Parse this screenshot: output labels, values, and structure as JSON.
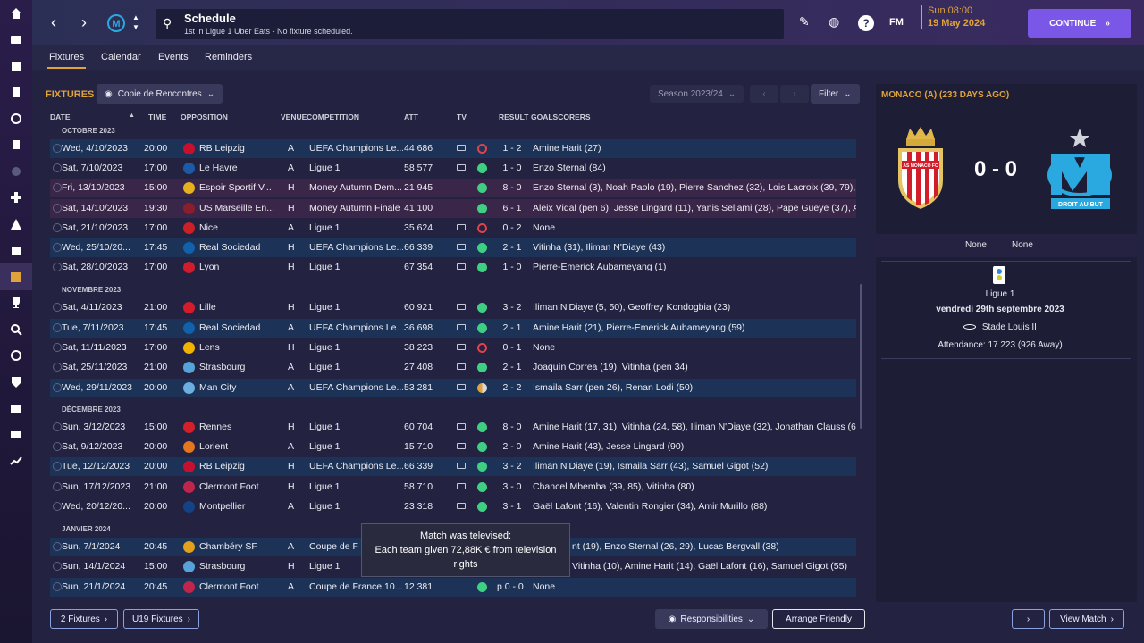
{
  "header": {
    "title": "Schedule",
    "subtitle": "1st in Ligue 1 Uber Eats - No fixture scheduled.",
    "fm_label": "FM",
    "date_time": "Sun 08:00",
    "date": "19 May 2024",
    "continue_label": "CONTINUE"
  },
  "tabs": [
    "Fixtures",
    "Calendar",
    "Events",
    "Reminders"
  ],
  "toolbar": {
    "fixtures_title": "FIXTURES",
    "view_dropdown": "Copie de Rencontres",
    "season": "Season 2023/24",
    "filter_label": "Filter"
  },
  "table": {
    "columns": [
      "DATE",
      "TIME",
      "OPPOSITION",
      "VENUE",
      "COMPETITION",
      "ATT",
      "TV",
      "RESULT",
      "GOALSCORERS"
    ],
    "sections": [
      "OCTOBRE 2023",
      "NOVEMBRE 2023",
      "DÉCEMBRE 2023",
      "JANVIER 2024"
    ],
    "rows": [
      {
        "date": "Wed, 4/10/2023",
        "time": "20:00",
        "opp": "RB Leipzig",
        "venue": "A",
        "comp": "UEFA Champions Le...",
        "att": "44 686",
        "result": "1 - 2",
        "scorers": "Amine Harit (27)"
      },
      {
        "date": "Sat, 7/10/2023",
        "time": "17:00",
        "opp": "Le Havre",
        "venue": "A",
        "comp": "Ligue 1",
        "att": "58 577",
        "result": "1 - 0",
        "scorers": "Enzo Sternal (84)"
      },
      {
        "date": "Fri, 13/10/2023",
        "time": "15:00",
        "opp": "Espoir Sportif V...",
        "venue": "H",
        "comp": "Money Autumn Dem...",
        "att": "21 945",
        "result": "8 - 0",
        "scorers": "Enzo Sternal (3), Noah Paolo (19), Pierre Sanchez (32), Lois Lacroix (39, 79), Joa"
      },
      {
        "date": "Sat, 14/10/2023",
        "time": "19:30",
        "opp": "US Marseille En...",
        "venue": "H",
        "comp": "Money Autumn Finale",
        "att": "41 100",
        "result": "6 - 1",
        "scorers": "Aleix Vidal (pen 6), Jesse Lingard (11), Yanis Sellami (28), Pape Gueye (37), Ama..."
      },
      {
        "date": "Sat, 21/10/2023",
        "time": "17:00",
        "opp": "Nice",
        "venue": "A",
        "comp": "Ligue 1",
        "att": "35 624",
        "result": "0 - 2",
        "scorers": "None"
      },
      {
        "date": "Wed, 25/10/20...",
        "time": "17:45",
        "opp": "Real Sociedad",
        "venue": "H",
        "comp": "UEFA Champions Le...",
        "att": "66 339",
        "result": "2 - 1",
        "scorers": "Vitinha (31), Iliman N'Diaye (43)"
      },
      {
        "date": "Sat, 28/10/2023",
        "time": "17:00",
        "opp": "Lyon",
        "venue": "H",
        "comp": "Ligue 1",
        "att": "67 354",
        "result": "1 - 0",
        "scorers": "Pierre-Emerick Aubameyang (1)"
      },
      {
        "date": "Sat, 4/11/2023",
        "time": "21:00",
        "opp": "Lille",
        "venue": "H",
        "comp": "Ligue 1",
        "att": "60 921",
        "result": "3 - 2",
        "scorers": "Iliman N'Diaye (5, 50), Geoffrey Kondogbia (23)"
      },
      {
        "date": "Tue, 7/11/2023",
        "time": "17:45",
        "opp": "Real Sociedad",
        "venue": "A",
        "comp": "UEFA Champions Le...",
        "att": "36 698",
        "result": "2 - 1",
        "scorers": "Amine Harit (21), Pierre-Emerick Aubameyang (59)"
      },
      {
        "date": "Sat, 11/11/2023",
        "time": "17:00",
        "opp": "Lens",
        "venue": "H",
        "comp": "Ligue 1",
        "att": "38 223",
        "result": "0 - 1",
        "scorers": "None"
      },
      {
        "date": "Sat, 25/11/2023",
        "time": "21:00",
        "opp": "Strasbourg",
        "venue": "A",
        "comp": "Ligue 1",
        "att": "27 408",
        "result": "2 - 1",
        "scorers": "Joaquín Correa (19), Vitinha (pen 34)"
      },
      {
        "date": "Wed, 29/11/2023",
        "time": "20:00",
        "opp": "Man City",
        "venue": "A",
        "comp": "UEFA Champions Le...",
        "att": "53 281",
        "result": "2 - 2",
        "scorers": "Ismaila Sarr (pen 26), Renan Lodi (50)"
      },
      {
        "date": "Sun, 3/12/2023",
        "time": "15:00",
        "opp": "Rennes",
        "venue": "H",
        "comp": "Ligue 1",
        "att": "60 704",
        "result": "8 - 0",
        "scorers": "Amine Harit (17, 31), Vitinha (24, 58), Iliman N'Diaye (32), Jonathan Clauss (66),..."
      },
      {
        "date": "Sat, 9/12/2023",
        "time": "20:00",
        "opp": "Lorient",
        "venue": "A",
        "comp": "Ligue 1",
        "att": "15 710",
        "result": "2 - 0",
        "scorers": "Amine Harit (43), Jesse Lingard (90)"
      },
      {
        "date": "Tue, 12/12/2023",
        "time": "20:00",
        "opp": "RB Leipzig",
        "venue": "H",
        "comp": "UEFA Champions Le...",
        "att": "66 339",
        "result": "3 - 2",
        "scorers": "Iliman N'Diaye (19), Ismaila Sarr (43), Samuel Gigot (52)"
      },
      {
        "date": "Sun, 17/12/2023",
        "time": "21:00",
        "opp": "Clermont Foot",
        "venue": "H",
        "comp": "Ligue 1",
        "att": "58 710",
        "result": "3 - 0",
        "scorers": "Chancel Mbemba (39, 85), Vitinha (80)"
      },
      {
        "date": "Wed, 20/12/20...",
        "time": "20:00",
        "opp": "Montpellier",
        "venue": "A",
        "comp": "Ligue 1",
        "att": "23 318",
        "result": "3 - 1",
        "scorers": "Gaël Lafont (16), Valentin Rongier (34), Amir Murillo (88)"
      },
      {
        "date": "Sun, 7/1/2024",
        "time": "20:45",
        "opp": "Chambéry SF",
        "venue": "A",
        "comp": "Coupe de F",
        "att": "",
        "result": "",
        "scorers": "nt (19), Enzo Sternal (26, 29), Lucas Bergvall (38)"
      },
      {
        "date": "Sun, 14/1/2024",
        "time": "15:00",
        "opp": "Strasbourg",
        "venue": "H",
        "comp": "Ligue 1",
        "att": "",
        "result": "",
        "scorers": "Vitinha (10), Amine Harit (14), Gaël Lafont (16), Samuel Gigot (55)"
      },
      {
        "date": "Sun, 21/1/2024",
        "time": "20:45",
        "opp": "Clermont Foot",
        "venue": "A",
        "comp": "Coupe de France 10...",
        "att": "12 381",
        "result": "p 0 - 0",
        "scorers": "None"
      }
    ]
  },
  "tooltip": {
    "line1": "Match was televised:",
    "line2": "Each team given 72,88K € from television rights"
  },
  "right_panel": {
    "title": "MONACO (A) (233 DAYS AGO)",
    "score": "0 - 0",
    "home_scorers": "None",
    "away_scorers": "None",
    "competition": "Ligue 1",
    "date": "vendredi 29th septembre 2023",
    "stadium": "Stade Louis II",
    "attendance": "Attendance: 17 223 (926 Away)",
    "home_crest_text": "AS MONACO FC",
    "away_crest_text": "DROIT AU BUT"
  },
  "bottom": {
    "fixtures_btn": "2 Fixtures",
    "u19_btn": "U19 Fixtures",
    "responsibilities": "Responsibilities",
    "arrange": "Arrange Friendly",
    "view_match": "View Match"
  },
  "colors": {
    "accent": "#e0a33b",
    "continue": "#7b57e8",
    "win": "#3fcf82",
    "loss": "#e0434b"
  }
}
